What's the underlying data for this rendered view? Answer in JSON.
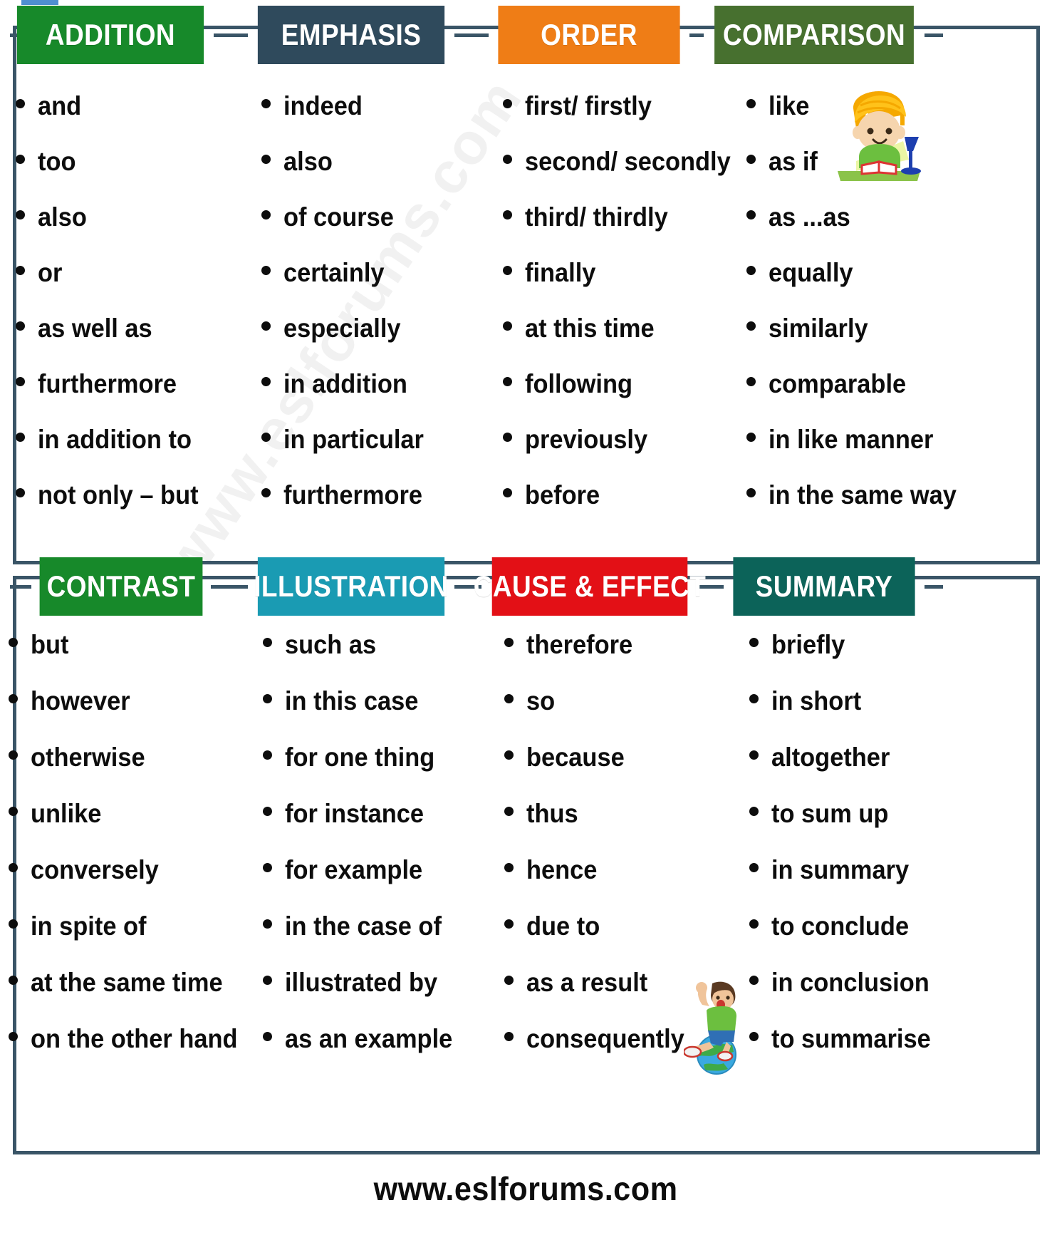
{
  "theme": {
    "frame_color": "#3a5567",
    "text_color": "#0d0d0d",
    "background": "#ffffff"
  },
  "artifact": {
    "name": "blue-artifact-bar",
    "color": "#4f8fd0"
  },
  "watermark": {
    "text": "www.eslforums.com"
  },
  "footer": {
    "url": "www.eslforums.com"
  },
  "illustrations": [
    {
      "name": "boy-reading-with-lamp-illustration"
    },
    {
      "name": "boy-on-globe-illustration"
    }
  ],
  "panels": [
    {
      "id": "top",
      "columns": [
        {
          "key": "addition",
          "header": "ADDITION",
          "color": "#17892a",
          "items": [
            "and",
            "too",
            "also",
            "or",
            "as well as",
            "furthermore",
            "in addition to",
            "not only – but"
          ]
        },
        {
          "key": "emphasis",
          "header": "EMPHASIS",
          "color": "#2f4a5c",
          "items": [
            "indeed",
            "also",
            "of course",
            "certainly",
            "especially",
            "in addition",
            "in particular",
            "furthermore"
          ]
        },
        {
          "key": "order",
          "header": "ORDER",
          "color": "#ef7d16",
          "items": [
            "first/ firstly",
            "second/ secondly",
            "third/ thirdly",
            "finally",
            "at this time",
            "following",
            "previously",
            "before"
          ]
        },
        {
          "key": "comparison",
          "header": "COMPARISON",
          "color": "#47702f",
          "items": [
            "like",
            "as if",
            "as ...as",
            "equally",
            "similarly",
            "comparable",
            "in like manner",
            "in the same way"
          ]
        }
      ]
    },
    {
      "id": "bottom",
      "columns": [
        {
          "key": "contrast",
          "header": "CONTRAST",
          "color": "#17892a",
          "items": [
            "but",
            "however",
            "otherwise",
            "unlike",
            "conversely",
            "in spite of",
            "at the same time",
            "on the other hand"
          ]
        },
        {
          "key": "illustration",
          "header": "ILLUSTRATION",
          "color": "#1a9bb3",
          "items": [
            " such as",
            "in this case",
            "for one thing",
            "for instance",
            "for example",
            "in the case of",
            "illustrated by",
            "as an example"
          ]
        },
        {
          "key": "cause_effect",
          "header": "CAUSE & EFFECT",
          "color": "#e31016",
          "items": [
            "therefore",
            "so",
            "because",
            "thus",
            "hence",
            "due to",
            "as a result",
            "consequently"
          ]
        },
        {
          "key": "summary",
          "header": "SUMMARY",
          "color": "#0c6359",
          "items": [
            "briefly",
            "in short",
            "altogether",
            "to sum up",
            "in summary",
            "to conclude",
            "in conclusion",
            "to summarise"
          ]
        }
      ]
    }
  ]
}
